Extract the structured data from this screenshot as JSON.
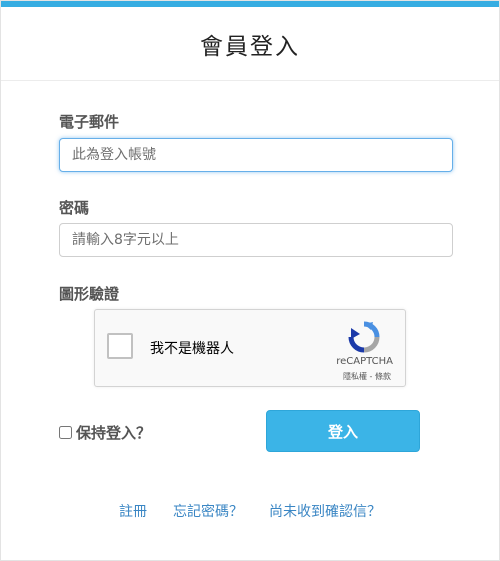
{
  "header": {
    "title": "會員登入"
  },
  "email": {
    "label": "電子郵件",
    "placeholder": "此為登入帳號"
  },
  "password": {
    "label": "密碼",
    "placeholder": "請輸入8字元以上"
  },
  "captcha": {
    "label": "圖形驗證",
    "checkbox_text": "我不是機器人",
    "brand": "reCAPTCHA",
    "terms": "隱私權 - 條款"
  },
  "remember": {
    "label": "保持登入？",
    "checked": false
  },
  "actions": {
    "login_label": "登入"
  },
  "links": [
    {
      "label": "註冊"
    },
    {
      "label": "忘記密碼？"
    },
    {
      "label": "尚未收到確認信？"
    }
  ],
  "colors": {
    "accent": "#36ade2",
    "button": "#3bb4e7",
    "link": "#3a86c4"
  }
}
